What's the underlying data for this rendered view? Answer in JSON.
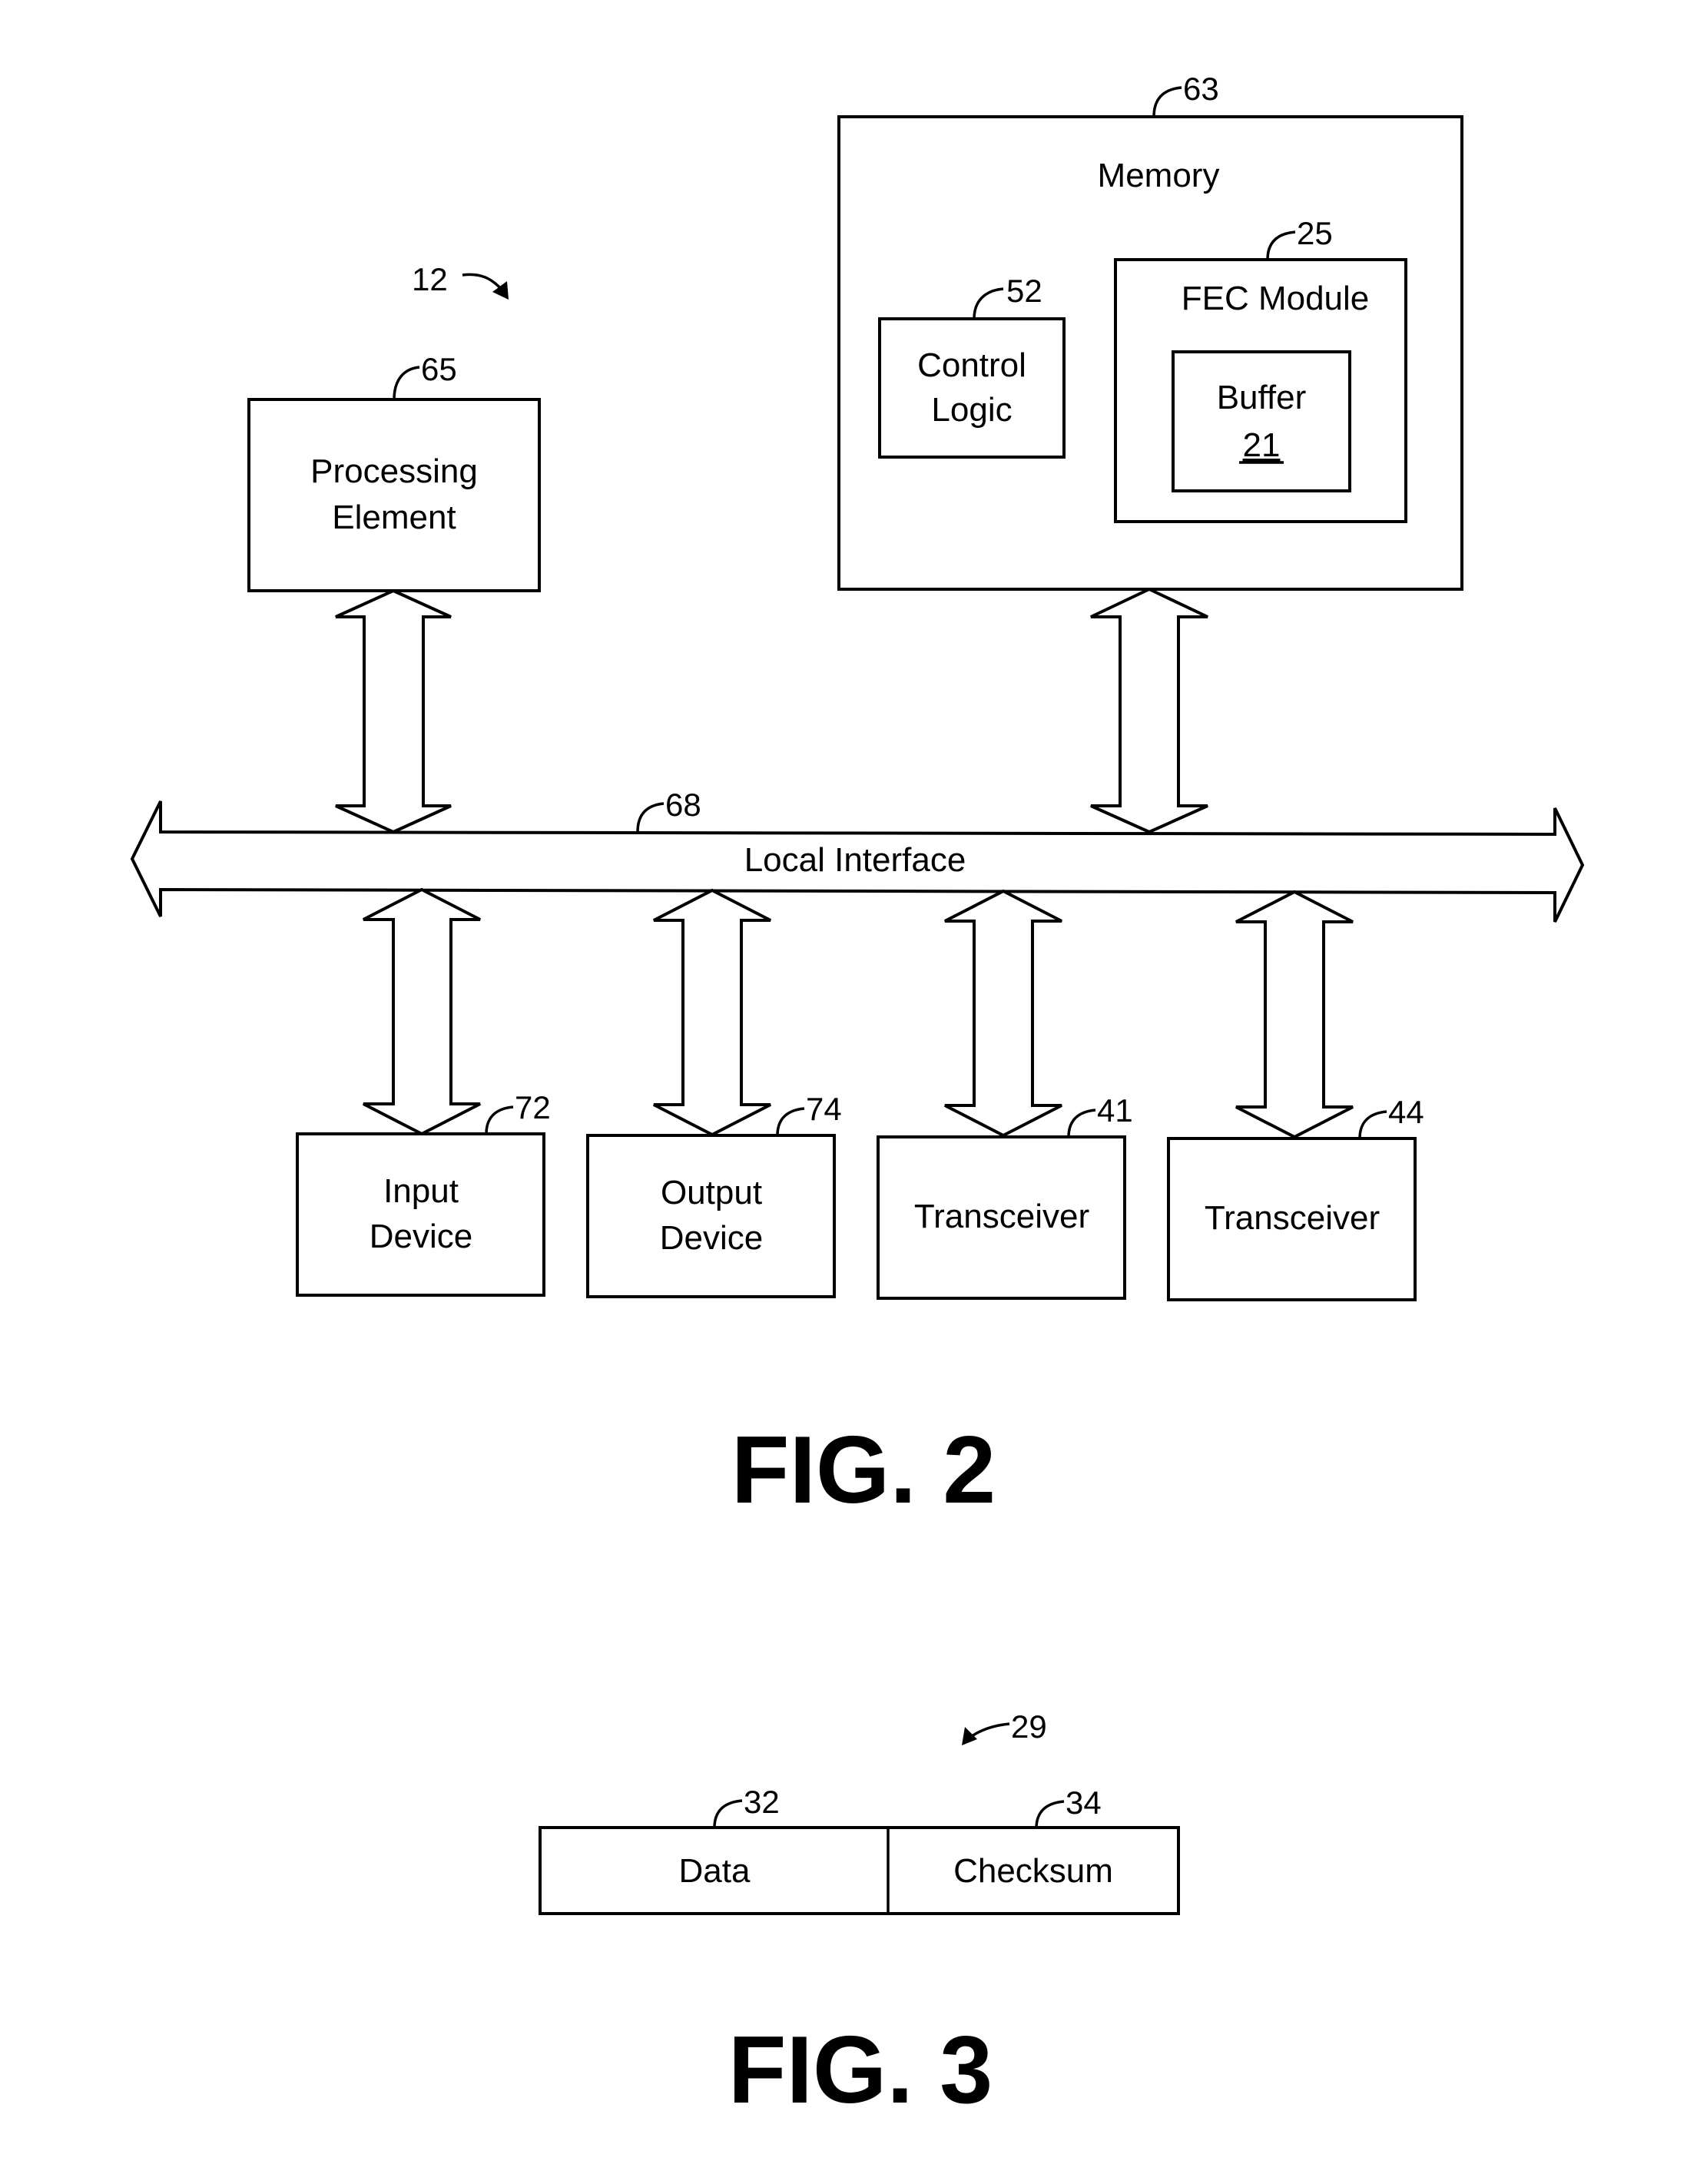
{
  "figures": {
    "fig2": {
      "caption": "FIG. 2",
      "system_ref": "12",
      "processing_element": {
        "label_line1": "Processing",
        "label_line2": "Element",
        "ref": "65"
      },
      "memory": {
        "label": "Memory",
        "ref": "63",
        "control_logic": {
          "label_line1": "Control",
          "label_line2": "Logic",
          "ref": "52"
        },
        "fec_module": {
          "label": "FEC Module",
          "ref": "25",
          "buffer": {
            "label": "Buffer",
            "ref": "21"
          }
        }
      },
      "local_interface": {
        "label": "Local Interface",
        "ref": "68"
      },
      "devices": [
        {
          "label_line1": "Input",
          "label_line2": "Device",
          "ref": "72"
        },
        {
          "label_line1": "Output",
          "label_line2": "Device",
          "ref": "74"
        },
        {
          "label_line1": "Transceiver",
          "label_line2": "",
          "ref": "41"
        },
        {
          "label_line1": "Transceiver",
          "label_line2": "",
          "ref": "44"
        }
      ]
    },
    "fig3": {
      "caption": "FIG. 3",
      "packet_ref": "29",
      "fields": [
        {
          "label": "Data",
          "ref": "32"
        },
        {
          "label": "Checksum",
          "ref": "34"
        }
      ]
    }
  }
}
